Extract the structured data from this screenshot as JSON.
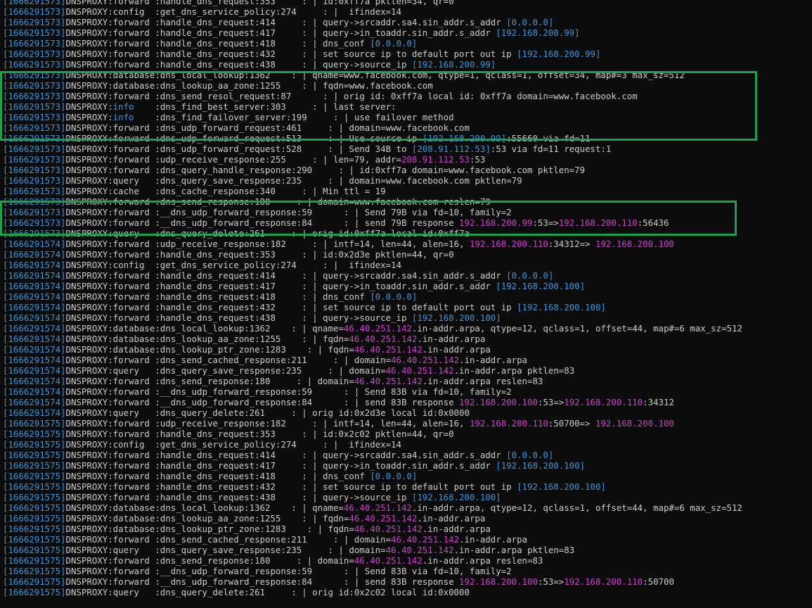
{
  "highlight_color": "#16a34a",
  "lines": [
    [
      [
        "c",
        "[1666291573]"
      ],
      [
        "w",
        "DNSPROXY:forward :handle_dns_request:353     : | id:0xff7a pktlen=34, qr=0"
      ]
    ],
    [
      [
        "c",
        "[1666291573]"
      ],
      [
        "w",
        "DNSPROXY:config  :get_dns_service_policy:274     : |  ifindex=14"
      ]
    ],
    [
      [
        "c",
        "[1666291573]"
      ],
      [
        "w",
        "DNSPROXY:forward :handle_dns_request:414     : | query->srcaddr.sa4.sin_addr.s_addr "
      ],
      [
        "c",
        "[0.0.0.0]"
      ]
    ],
    [
      [
        "c",
        "[1666291573]"
      ],
      [
        "w",
        "DNSPROXY:forward :handle_dns_request:417     : | query->in_toaddr.sin_addr.s_addr "
      ],
      [
        "c",
        "[192.168.200.99]"
      ]
    ],
    [
      [
        "c",
        "[1666291573]"
      ],
      [
        "w",
        "DNSPROXY:forward :handle_dns_request:418     : | dns_conf "
      ],
      [
        "c",
        "[0.0.0.0]"
      ]
    ],
    [
      [
        "c",
        "[1666291573]"
      ],
      [
        "w",
        "DNSPROXY:forward :handle_dns_request:432     : | set source ip to default port out ip "
      ],
      [
        "c",
        "[192.168.200.99]"
      ]
    ],
    [
      [
        "c",
        "[1666291573]"
      ],
      [
        "w",
        "DNSPROXY:forward :handle_dns_request:438     : | query->source_ip "
      ],
      [
        "c",
        "[192.168.200.99]"
      ]
    ],
    [
      [
        "c",
        "[1666291573]"
      ],
      [
        "w",
        "DNSPROXY:database:dns_local_lookup:1362    : | qname=www.facebook.com, qtype=1, qclass=1, offset=34, map#=3 max_sz=512"
      ]
    ],
    [
      [
        "c",
        "[1666291573]"
      ],
      [
        "w",
        "DNSPROXY:database:dns_lookup_aa_zone:1255    : | fqdn=www.facebook.com"
      ]
    ],
    [
      [
        "c",
        "[1666291573]"
      ],
      [
        "w",
        "DNSPROXY:forward :dns_send_resol_request:87      : | orig id: 0xff7a local id: 0xff7a domain=www.facebook.com"
      ]
    ],
    [
      [
        "c",
        "[1666291573]"
      ],
      [
        "w",
        "DNSPROXY:"
      ],
      [
        "c",
        "info"
      ],
      [
        "w",
        "    :dns_find_best_server:303     : | last server:"
      ]
    ],
    [
      [
        "c",
        "[1666291573]"
      ],
      [
        "w",
        "DNSPROXY:"
      ],
      [
        "c",
        "info"
      ],
      [
        "w",
        "    :dns_find_failover_server:199     : | use failover method"
      ]
    ],
    [
      [
        "c",
        "[1666291573]"
      ],
      [
        "w",
        "DNSPROXY:forward :dns_udp_forward_request:461     : | domain=www.facebook.com"
      ]
    ],
    [
      [
        "c",
        "[1666291573]"
      ],
      [
        "w",
        "DNSPROXY:forward :dns_udp_forward_request:513     : | Use source ip "
      ],
      [
        "c",
        "[192.168.200.99]"
      ],
      [
        "w",
        ":55660 via fd=11"
      ]
    ],
    [
      [
        "c",
        "[1666291573]"
      ],
      [
        "w",
        "DNSPROXY:forward :dns_udp_forward_request:528     : | Send 34B to "
      ],
      [
        "c",
        "[208.91.112.53]"
      ],
      [
        "w",
        ":53 via fd=11 request:1"
      ]
    ],
    [
      [
        "c",
        "[1666291573]"
      ],
      [
        "w",
        "DNSPROXY:forward :udp_receive_response:255     : | len=79, addr="
      ],
      [
        "m",
        "208.91.112.53"
      ],
      [
        "w",
        ":53"
      ]
    ],
    [
      [
        "c",
        "[1666291573]"
      ],
      [
        "w",
        "DNSPROXY:forward :dns_query_handle_response:290     : | id:0xff7a domain=www.facebook.com pktlen=79"
      ]
    ],
    [
      [
        "c",
        "[1666291573]"
      ],
      [
        "w",
        "DNSPROXY:query   :dns_query_save_response:235     : | domain=www.facebook.com pktlen=79"
      ]
    ],
    [
      [
        "c",
        "[1666291573]"
      ],
      [
        "w",
        "DNSPROXY:cache   :dns_cache_response:340     : | Min ttl = 19"
      ]
    ],
    [
      [
        "c",
        "[1666291573]"
      ],
      [
        "w",
        "DNSPROXY:forward :dns_send_response:180     : | domain=www.facebook.com reslen=79"
      ]
    ],
    [
      [
        "c",
        "[1666291573]"
      ],
      [
        "w",
        "DNSPROXY:forward :__dns_udp_forward_response:59      : | Send 79B via fd=10, family=2"
      ]
    ],
    [
      [
        "c",
        "[1666291573]"
      ],
      [
        "w",
        "DNSPROXY:forward :__dns_udp_forward_response:84      : | send 79B response "
      ],
      [
        "m",
        "192.168.200.99"
      ],
      [
        "w",
        ":53=>"
      ],
      [
        "m",
        "192.168.200.110"
      ],
      [
        "w",
        ":56436"
      ]
    ],
    [
      [
        "c",
        "[1666291573]"
      ],
      [
        "w",
        "DNSPROXY:query   :dns_query_delete:261     : | orig id:0xff7a local id:0xff7a"
      ]
    ],
    [
      [
        "c",
        "[1666291574]"
      ],
      [
        "w",
        "DNSPROXY:forward :udp_receive_response:182     : | intf=14, len=44, alen=16, "
      ],
      [
        "m",
        "192.168.200.110"
      ],
      [
        "w",
        ":34312=> "
      ],
      [
        "m",
        "192.168.200.100"
      ]
    ],
    [
      [
        "c",
        "[1666291574]"
      ],
      [
        "w",
        "DNSPROXY:forward :handle_dns_request:353     : | id:0x2d3e pktlen=44, qr=0"
      ]
    ],
    [
      [
        "c",
        "[1666291574]"
      ],
      [
        "w",
        "DNSPROXY:config  :get_dns_service_policy:274     : |  ifindex=14"
      ]
    ],
    [
      [
        "c",
        "[1666291574]"
      ],
      [
        "w",
        "DNSPROXY:forward :handle_dns_request:414     : | query->srcaddr.sa4.sin_addr.s_addr "
      ],
      [
        "c",
        "[0.0.0.0]"
      ]
    ],
    [
      [
        "c",
        "[1666291574]"
      ],
      [
        "w",
        "DNSPROXY:forward :handle_dns_request:417     : | query->in_toaddr.sin_addr.s_addr "
      ],
      [
        "c",
        "[192.168.200.100]"
      ]
    ],
    [
      [
        "c",
        "[1666291574]"
      ],
      [
        "w",
        "DNSPROXY:forward :handle_dns_request:418     : | dns_conf "
      ],
      [
        "c",
        "[0.0.0.0]"
      ]
    ],
    [
      [
        "c",
        "[1666291574]"
      ],
      [
        "w",
        "DNSPROXY:forward :handle_dns_request:432     : | set source ip to default port out ip "
      ],
      [
        "c",
        "[192.168.200.100]"
      ]
    ],
    [
      [
        "c",
        "[1666291574]"
      ],
      [
        "w",
        "DNSPROXY:forward :handle_dns_request:438     : | query->source_ip "
      ],
      [
        "c",
        "[192.168.200.100]"
      ]
    ],
    [
      [
        "c",
        "[1666291574]"
      ],
      [
        "w",
        "DNSPROXY:database:dns_local_lookup:1362    : | qname="
      ],
      [
        "m",
        "46.40.251.142"
      ],
      [
        "w",
        ".in-addr.arpa, qtype=12, qclass=1, offset=44, map#=6 max_sz=512"
      ]
    ],
    [
      [
        "c",
        "[1666291574]"
      ],
      [
        "w",
        "DNSPROXY:database:dns_lookup_aa_zone:1255    : | fqdn="
      ],
      [
        "m",
        "46.40.251.142"
      ],
      [
        "w",
        ".in-addr.arpa"
      ]
    ],
    [
      [
        "c",
        "[1666291574]"
      ],
      [
        "w",
        "DNSPROXY:database:dns_lookup_ptr_zone:1283    : | fqdn="
      ],
      [
        "m",
        "46.40.251.142"
      ],
      [
        "w",
        ".in-addr.arpa"
      ]
    ],
    [
      [
        "c",
        "[1666291574]"
      ],
      [
        "w",
        "DNSPROXY:forward :dns_send_cached_response:211     : | domain="
      ],
      [
        "m",
        "46.40.251.142"
      ],
      [
        "w",
        ".in-addr.arpa"
      ]
    ],
    [
      [
        "c",
        "[1666291574]"
      ],
      [
        "w",
        "DNSPROXY:query   :dns_query_save_response:235     : | domain="
      ],
      [
        "m",
        "46.40.251.142"
      ],
      [
        "w",
        ".in-addr.arpa pktlen=83"
      ]
    ],
    [
      [
        "c",
        "[1666291574]"
      ],
      [
        "w",
        "DNSPROXY:forward :dns_send_response:180     : | domain="
      ],
      [
        "m",
        "46.40.251.142"
      ],
      [
        "w",
        ".in-addr.arpa reslen=83"
      ]
    ],
    [
      [
        "c",
        "[1666291574]"
      ],
      [
        "w",
        "DNSPROXY:forward :__dns_udp_forward_response:59      : | Send 83B via fd=10, family=2"
      ]
    ],
    [
      [
        "c",
        "[1666291574]"
      ],
      [
        "w",
        "DNSPROXY:forward :__dns_udp_forward_response:84      : | send 83B response "
      ],
      [
        "m",
        "192.168.200.100"
      ],
      [
        "w",
        ":53=>"
      ],
      [
        "m",
        "192.168.200.110"
      ],
      [
        "w",
        ":34312"
      ]
    ],
    [
      [
        "c",
        "[1666291574]"
      ],
      [
        "w",
        "DNSPROXY:query   :dns_query_delete:261     : | orig id:0x2d3e local id:0x0000"
      ]
    ],
    [
      [
        "c",
        "[1666291575]"
      ],
      [
        "w",
        "DNSPROXY:forward :udp_receive_response:182     : | intf=14, len=44, alen=16, "
      ],
      [
        "m",
        "192.168.200.110"
      ],
      [
        "w",
        ":50700=> "
      ],
      [
        "m",
        "192.168.200.100"
      ]
    ],
    [
      [
        "c",
        "[1666291575]"
      ],
      [
        "w",
        "DNSPROXY:forward :handle_dns_request:353     : | id:0x2c02 pktlen=44, qr=0"
      ]
    ],
    [
      [
        "c",
        "[1666291575]"
      ],
      [
        "w",
        "DNSPROXY:config  :get_dns_service_policy:274     : |  ifindex=14"
      ]
    ],
    [
      [
        "c",
        "[1666291575]"
      ],
      [
        "w",
        "DNSPROXY:forward :handle_dns_request:414     : | query->srcaddr.sa4.sin_addr.s_addr "
      ],
      [
        "c",
        "[0.0.0.0]"
      ]
    ],
    [
      [
        "c",
        "[1666291575]"
      ],
      [
        "w",
        "DNSPROXY:forward :handle_dns_request:417     : | query->in_toaddr.sin_addr.s_addr "
      ],
      [
        "c",
        "[192.168.200.100]"
      ]
    ],
    [
      [
        "c",
        "[1666291575]"
      ],
      [
        "w",
        "DNSPROXY:forward :handle_dns_request:418     : | dns_conf "
      ],
      [
        "c",
        "[0.0.0.0]"
      ]
    ],
    [
      [
        "c",
        "[1666291575]"
      ],
      [
        "w",
        "DNSPROXY:forward :handle_dns_request:432     : | set source ip to default port out ip "
      ],
      [
        "c",
        "[192.168.200.100]"
      ]
    ],
    [
      [
        "c",
        "[1666291575]"
      ],
      [
        "w",
        "DNSPROXY:forward :handle_dns_request:438     : | query->source_ip "
      ],
      [
        "c",
        "[192.168.200.100]"
      ]
    ],
    [
      [
        "c",
        "[1666291575]"
      ],
      [
        "w",
        "DNSPROXY:database:dns_local_lookup:1362    : | qname="
      ],
      [
        "m",
        "46.40.251.142"
      ],
      [
        "w",
        ".in-addr.arpa, qtype=12, qclass=1, offset=44, map#=6 max_sz=512"
      ]
    ],
    [
      [
        "c",
        "[1666291575]"
      ],
      [
        "w",
        "DNSPROXY:database:dns_lookup_aa_zone:1255    : | fqdn="
      ],
      [
        "m",
        "46.40.251.142"
      ],
      [
        "w",
        ".in-addr.arpa"
      ]
    ],
    [
      [
        "c",
        "[1666291575]"
      ],
      [
        "w",
        "DNSPROXY:database:dns_lookup_ptr_zone:1283    : | fqdn="
      ],
      [
        "m",
        "46.40.251.142"
      ],
      [
        "w",
        ".in-addr.arpa"
      ]
    ],
    [
      [
        "c",
        "[1666291575]"
      ],
      [
        "w",
        "DNSPROXY:forward :dns_send_cached_response:211     : | domain="
      ],
      [
        "m",
        "46.40.251.142"
      ],
      [
        "w",
        ".in-addr.arpa"
      ]
    ],
    [
      [
        "c",
        "[1666291575]"
      ],
      [
        "w",
        "DNSPROXY:query   :dns_query_save_response:235     : | domain="
      ],
      [
        "m",
        "46.40.251.142"
      ],
      [
        "w",
        ".in-addr.arpa pktlen=83"
      ]
    ],
    [
      [
        "c",
        "[1666291575]"
      ],
      [
        "w",
        "DNSPROXY:forward :dns_send_response:180     : | domain="
      ],
      [
        "m",
        "46.40.251.142"
      ],
      [
        "w",
        ".in-addr.arpa reslen=83"
      ]
    ],
    [
      [
        "c",
        "[1666291575]"
      ],
      [
        "w",
        "DNSPROXY:forward :__dns_udp_forward_response:59      : | Send 83B via fd=10, family=2"
      ]
    ],
    [
      [
        "c",
        "[1666291575]"
      ],
      [
        "w",
        "DNSPROXY:forward :__dns_udp_forward_response:84      : | send 83B response "
      ],
      [
        "m",
        "192.168.200.100"
      ],
      [
        "w",
        ":53=>"
      ],
      [
        "m",
        "192.168.200.110"
      ],
      [
        "w",
        ":50700"
      ]
    ],
    [
      [
        "c",
        "[1666291575]"
      ],
      [
        "w",
        "DNSPROXY:query   :dns_query_delete:261     : | orig id:0x2c02 local id:0x0000"
      ]
    ]
  ]
}
